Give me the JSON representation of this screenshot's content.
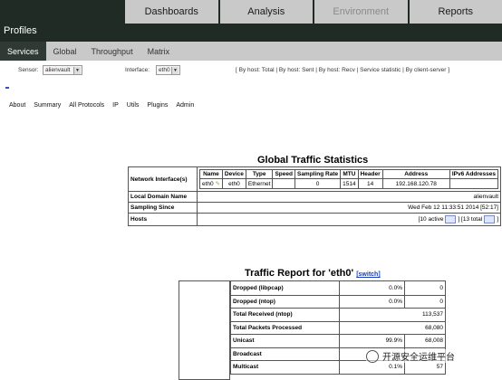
{
  "header": {
    "app_title": "Profiles",
    "nav": [
      {
        "label": "Dashboards",
        "state": "normal"
      },
      {
        "label": "Analysis",
        "state": "normal"
      },
      {
        "label": "Environment",
        "state": "inactive"
      },
      {
        "label": "Reports",
        "state": "normal"
      }
    ]
  },
  "subnav": {
    "tabs": [
      "Services",
      "Global",
      "Throughput",
      "Matrix"
    ],
    "active": "Services"
  },
  "filters": {
    "sensor_label": "Sensor:",
    "sensor_value": "alienvault",
    "interface_label": "Interface:",
    "interface_value": "eth0",
    "links": "[ By host: Total | By host: Sent | By host: Recv | Service statistic | By client-server ]"
  },
  "ntop_menu": [
    "About",
    "Summary",
    "All Protocols",
    "IP",
    "Utils",
    "Plugins",
    "Admin"
  ],
  "global_stats": {
    "title": "Global Traffic Statistics",
    "network_interfaces_label": "Network Interface(s)",
    "interface_headers": [
      "Name",
      "Device",
      "Type",
      "Speed",
      "Sampling Rate",
      "MTU",
      "Header",
      "Address",
      "IPv6 Addresses"
    ],
    "interface_row": {
      "name": "eth0",
      "device": "eth0",
      "type": "Ethernet",
      "speed": "",
      "sampling_rate": "0",
      "mtu": "1514",
      "header": "14",
      "address": "192.168.120.78",
      "ipv6": ""
    },
    "local_domain_label": "Local Domain Name",
    "local_domain_value": "alienvault",
    "sampling_since_label": "Sampling Since",
    "sampling_since_value": "Wed Feb 12 11:33:51 2014 [52:17]",
    "hosts_label": "Hosts",
    "hosts_active": "[10 active",
    "hosts_total": "] [13 total",
    "hosts_end": "]"
  },
  "traffic_report": {
    "title": "Traffic Report for 'eth0'",
    "switch_label": "[switch]",
    "rows": [
      {
        "label": "Dropped (libpcap)",
        "pct": "0.0%",
        "value": "0"
      },
      {
        "label": "Dropped (ntop)",
        "pct": "0.0%",
        "value": "0"
      },
      {
        "label": "Total Received (ntop)",
        "pct": "",
        "value": "113,537"
      },
      {
        "label": "Total Packets Processed",
        "pct": "",
        "value": "68,080"
      },
      {
        "label": "Unicast",
        "pct": "99.9%",
        "value": "68,008"
      },
      {
        "label": "Broadcast",
        "pct": "",
        "value": ""
      },
      {
        "label": "Multicast",
        "pct": "0.1%",
        "value": "57"
      }
    ]
  },
  "watermark": {
    "text": "开源安全运维平台"
  },
  "colors": {
    "header_bg": "#1f2b24",
    "nav_bg": "#c9c9c9",
    "active_subtab": "#2e3a33",
    "link_blue": "#1a3fb0"
  }
}
